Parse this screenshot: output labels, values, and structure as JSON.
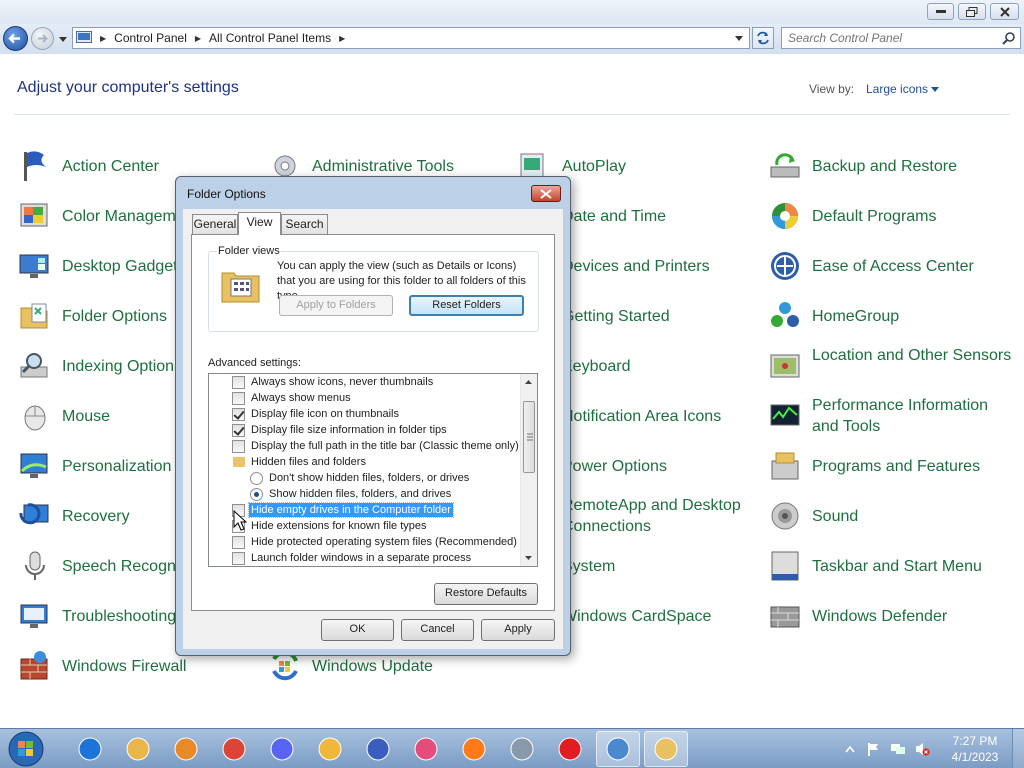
{
  "window": {
    "breadcrumb": [
      "Control Panel",
      "All Control Panel Items"
    ],
    "search_placeholder": "Search Control Panel"
  },
  "content": {
    "title": "Adjust your computer's settings",
    "view_by_label": "View by:",
    "view_by_value": "Large icons",
    "items": [
      {
        "label": "Action Center",
        "icon": "flag-icon"
      },
      {
        "label": "Color Managem",
        "icon": "color-management-icon"
      },
      {
        "label": "Desktop Gadgets",
        "icon": "gadgets-icon"
      },
      {
        "label": "Folder Options",
        "icon": "folder-icon"
      },
      {
        "label": "Indexing Option",
        "icon": "indexing-icon"
      },
      {
        "label": "Mouse",
        "icon": "mouse-icon"
      },
      {
        "label": "Personalization",
        "icon": "personalization-icon"
      },
      {
        "label": "Recovery",
        "icon": "recovery-icon"
      },
      {
        "label": "Speech Recognit",
        "icon": "microphone-icon"
      },
      {
        "label": "Troubleshooting",
        "icon": "troubleshooting-icon"
      },
      {
        "label": "Windows Firewall",
        "icon": "firewall-icon"
      },
      {
        "label": "Administrative Tools",
        "icon": "admin-tools-icon"
      },
      {
        "label": "Windows Update",
        "icon": "windows-update-icon"
      },
      {
        "label": "AutoPlay",
        "icon": "autoplay-icon"
      },
      {
        "label": "Date and Time",
        "icon": "clock-icon"
      },
      {
        "label": "Devices and Printers",
        "icon": "printer-icon"
      },
      {
        "label": "Getting Started",
        "icon": "getting-started-icon"
      },
      {
        "label": "Keyboard",
        "icon": "keyboard-icon"
      },
      {
        "label": "Notification Area Icons",
        "icon": "notification-icon"
      },
      {
        "label": "Power Options",
        "icon": "power-icon"
      },
      {
        "label": "RemoteApp and Desktop Connections",
        "icon": "remoteapp-icon"
      },
      {
        "label": "System",
        "icon": "system-icon"
      },
      {
        "label": "Windows CardSpace",
        "icon": "cardspace-icon"
      },
      {
        "label": "Backup and Restore",
        "icon": "backup-icon"
      },
      {
        "label": "Default Programs",
        "icon": "default-programs-icon"
      },
      {
        "label": "Ease of Access Center",
        "icon": "ease-of-access-icon"
      },
      {
        "label": "HomeGroup",
        "icon": "homegroup-icon"
      },
      {
        "label": "Location and Other Sensors",
        "icon": "location-icon"
      },
      {
        "label": "Performance Information and Tools",
        "icon": "performance-icon"
      },
      {
        "label": "Programs and Features",
        "icon": "programs-icon"
      },
      {
        "label": "Sound",
        "icon": "speaker-icon"
      },
      {
        "label": "Taskbar and Start Menu",
        "icon": "taskbar-icon"
      },
      {
        "label": "Windows Defender",
        "icon": "defender-icon"
      }
    ]
  },
  "dialog": {
    "title": "Folder Options",
    "tabs": [
      "General",
      "View",
      "Search"
    ],
    "active_tab": "View",
    "folder_views_legend": "Folder views",
    "folder_views_text": "You can apply the view (such as Details or Icons) that you are using for this folder to all folders of this type.",
    "apply_to_folders": "Apply to Folders",
    "reset_folders": "Reset Folders",
    "advanced_label": "Advanced settings:",
    "advanced_items": [
      {
        "type": "checkbox",
        "checked": false,
        "label": "Always show icons, never thumbnails"
      },
      {
        "type": "checkbox",
        "checked": false,
        "label": "Always show menus"
      },
      {
        "type": "checkbox",
        "checked": true,
        "label": "Display file icon on thumbnails"
      },
      {
        "type": "checkbox",
        "checked": true,
        "label": "Display file size information in folder tips"
      },
      {
        "type": "checkbox",
        "checked": false,
        "label": "Display the full path in the title bar (Classic theme only)"
      },
      {
        "type": "group",
        "label": "Hidden files and folders"
      },
      {
        "type": "radio",
        "checked": false,
        "label": "Don't show hidden files, folders, or drives"
      },
      {
        "type": "radio",
        "checked": true,
        "label": "Show hidden files, folders, and drives"
      },
      {
        "type": "checkbox",
        "checked": false,
        "selected": true,
        "label": "Hide empty drives in the Computer folder"
      },
      {
        "type": "checkbox",
        "checked": false,
        "label": "Hide extensions for known file types"
      },
      {
        "type": "checkbox",
        "checked": false,
        "label": "Hide protected operating system files (Recommended)"
      },
      {
        "type": "checkbox",
        "checked": false,
        "label": "Launch folder windows in a separate process"
      }
    ],
    "restore_defaults": "Restore Defaults",
    "ok": "OK",
    "cancel": "Cancel",
    "apply": "Apply"
  },
  "taskbar": {
    "apps": [
      "internet-explorer-icon",
      "windows-explorer-icon",
      "media-player-icon",
      "chrome-icon",
      "discord-icon",
      "keepass-icon",
      "launcher-icon",
      "opera-gx-icon",
      "firefox-icon",
      "fax-scan-icon",
      "opera-icon",
      "control-panel-icon",
      "folder-options-icon"
    ],
    "time": "7:27 PM",
    "date": "4/1/2023"
  },
  "colors": {
    "item_text": "#1e6f3f",
    "title_text": "#1e3287",
    "selection": "#3399ff",
    "taskbar": "#8aa8cf"
  }
}
